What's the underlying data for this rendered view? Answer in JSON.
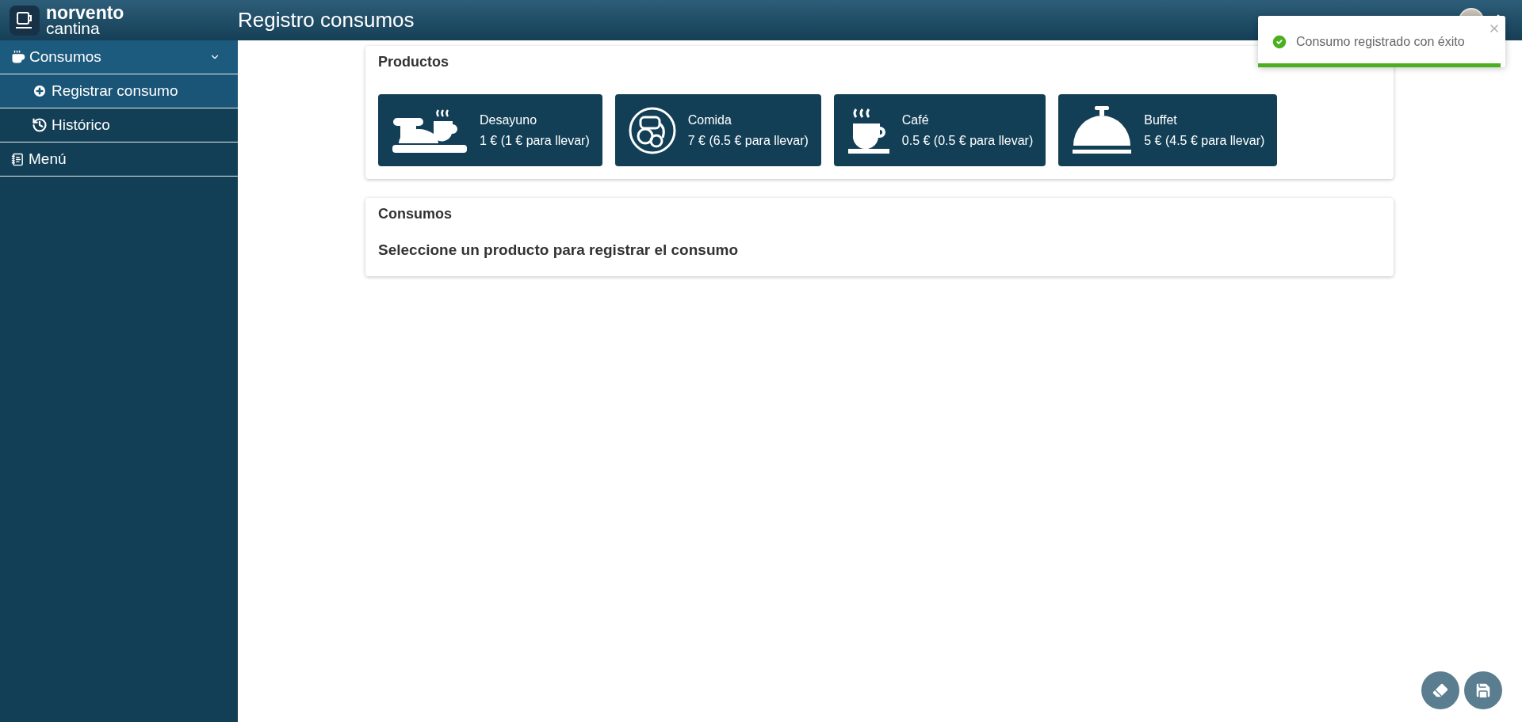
{
  "app": {
    "logo_name": "norvento",
    "logo_sub": "cantina"
  },
  "header": {
    "title": "Registro consumos"
  },
  "sidebar": {
    "items": [
      {
        "kind": "group",
        "label": "Consumos",
        "expanded": true,
        "children": [
          {
            "label": "Registrar consumo",
            "selected": true
          },
          {
            "label": "Histórico",
            "selected": false
          }
        ]
      },
      {
        "kind": "link",
        "label": "Menú",
        "selected": false
      }
    ]
  },
  "products": {
    "title": "Productos",
    "items": [
      {
        "name": "Desayuno",
        "price": "1 € (1 € para llevar)"
      },
      {
        "name": "Comida",
        "price": "7 € (6.5 € para llevar)"
      },
      {
        "name": "Café",
        "price": "0.5 € (0.5 € para llevar)"
      },
      {
        "name": "Buffet",
        "price": "5 € (4.5 € para llevar)"
      }
    ]
  },
  "consumos": {
    "title": "Consumos",
    "message": "Seleccione un producto para registrar el consumo"
  },
  "toast": {
    "message": "Consumo registrado con éxito",
    "level": 0.98
  },
  "actions": [
    {
      "kind": "clear"
    },
    {
      "kind": "save"
    }
  ]
}
